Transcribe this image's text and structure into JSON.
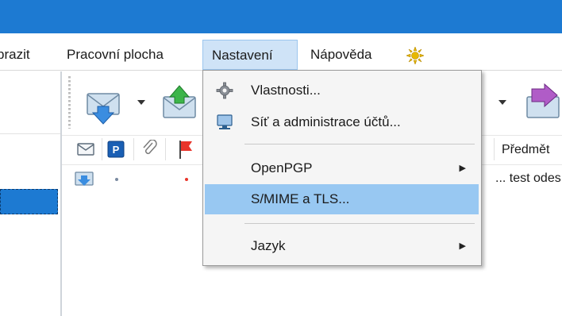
{
  "menubar": {
    "items": [
      {
        "label": "brazit",
        "active": false
      },
      {
        "label": "Pracovní plocha",
        "active": false
      },
      {
        "label": "Nastavení",
        "active": true
      },
      {
        "label": "Nápověda",
        "active": false
      }
    ]
  },
  "dropdown": {
    "items": [
      {
        "label": "Vlastnosti...",
        "icon": "gear-icon",
        "submenu": false,
        "highlighted": false
      },
      {
        "label": "Síť a administrace účtů...",
        "icon": "network-computer-icon",
        "submenu": false,
        "highlighted": false
      },
      {
        "label": "OpenPGP",
        "icon": "",
        "submenu": true,
        "highlighted": false
      },
      {
        "label": "S/MIME a TLS...",
        "icon": "",
        "submenu": false,
        "highlighted": true
      },
      {
        "label": "Jazyk",
        "icon": "",
        "submenu": true,
        "highlighted": false
      }
    ],
    "submenu_arrow": "▶"
  },
  "message_list": {
    "subject_header": "Předmět",
    "rows": [
      {
        "subject": "... test odes"
      }
    ]
  },
  "colors": {
    "title_bar": "#1d7ad2",
    "menu_active_bg": "#cfe3f7",
    "dropdown_highlight": "#98c8f2",
    "flag": "#e8342a",
    "pgp_badge": "#1a5fb4"
  }
}
